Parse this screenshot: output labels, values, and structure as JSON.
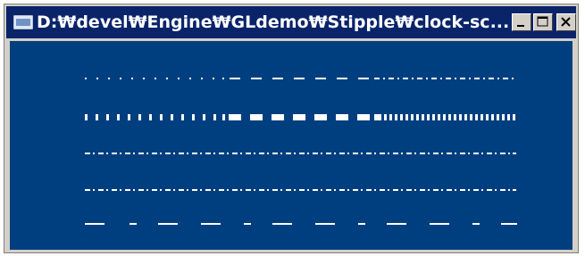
{
  "window": {
    "title": "D:₩devel₩Engine₩GLdemo₩Stipple₩clock-sc...",
    "app_icon": "app-window-icon",
    "buttons": [
      {
        "name": "minimize-button",
        "icon": "minimize-icon"
      },
      {
        "name": "maximize-button",
        "icon": "maximize-icon"
      },
      {
        "name": "close-button",
        "icon": "close-icon"
      }
    ]
  },
  "client": {
    "background": "#003f7f",
    "line_color": "#ffffff",
    "rows": [
      {
        "name": "stipple-row-1",
        "segments": [
          "dotted",
          "dashed",
          "dash-dot"
        ]
      },
      {
        "name": "stipple-row-2",
        "segments": [
          "thick-ticks",
          "thick-dashed",
          "thick-dense-ticks"
        ]
      },
      {
        "name": "stipple-row-3",
        "segments": [
          "dash-dot"
        ]
      },
      {
        "name": "stipple-row-4",
        "segments": [
          "dash-dot"
        ]
      },
      {
        "name": "stipple-row-5",
        "segments": [
          "long-short-dash"
        ]
      }
    ]
  }
}
